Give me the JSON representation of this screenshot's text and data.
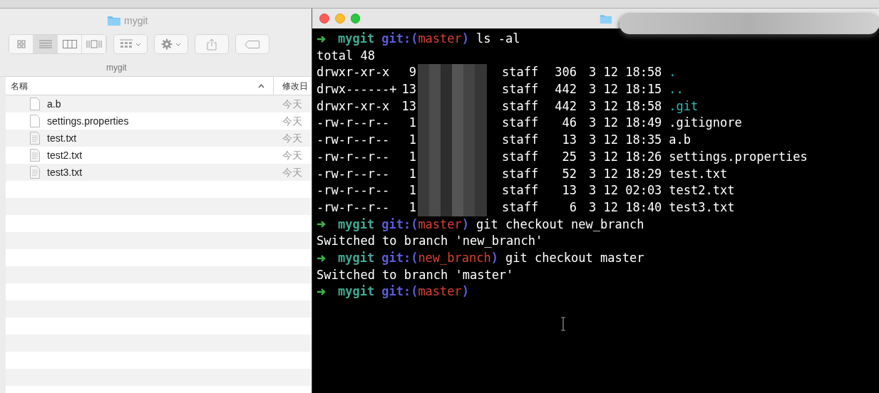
{
  "finder": {
    "title": "mygit",
    "path": "mygit",
    "view_modes": [
      {
        "kind": "icons",
        "selected": false
      },
      {
        "kind": "list",
        "selected": true
      },
      {
        "kind": "columns",
        "selected": false
      },
      {
        "kind": "cover",
        "selected": false
      }
    ],
    "columns": [
      {
        "label": "名稱",
        "sorted": true
      },
      {
        "label": "修改日",
        "sorted": false
      }
    ],
    "files": [
      {
        "name": "a.b",
        "modified": "今天",
        "kind": "blank"
      },
      {
        "name": "settings.properties",
        "modified": "今天",
        "kind": "blank"
      },
      {
        "name": "test.txt",
        "modified": "今天",
        "kind": "text"
      },
      {
        "name": "test2.txt",
        "modified": "今天",
        "kind": "text"
      },
      {
        "name": "test3.txt",
        "modified": "今天",
        "kind": "text"
      }
    ]
  },
  "terminal": {
    "lines": [
      {
        "kind": "prompt",
        "dir": "mygit",
        "vcs_open": "git:(",
        "branch": "master",
        "vcs_close": ")",
        "command": "ls -al"
      },
      {
        "kind": "output",
        "text": "total 48"
      },
      {
        "kind": "listing",
        "perms": "drwxr-xr-x",
        "links": "9",
        "group": "staff",
        "size": "306",
        "date": "3 12 18:58",
        "name": ".",
        "is_dir": true
      },
      {
        "kind": "listing",
        "perms": "drwx------+",
        "links": "13",
        "group": "staff",
        "size": "442",
        "date": "3 12 18:15",
        "name": "..",
        "is_dir": true
      },
      {
        "kind": "listing",
        "perms": "drwxr-xr-x",
        "links": "13",
        "group": "staff",
        "size": "442",
        "date": "3 12 18:58",
        "name": ".git",
        "is_dir": true
      },
      {
        "kind": "listing",
        "perms": "-rw-r--r--",
        "links": "1",
        "group": "staff",
        "size": "46",
        "date": "3 12 18:49",
        "name": ".gitignore",
        "is_dir": false
      },
      {
        "kind": "listing",
        "perms": "-rw-r--r--",
        "links": "1",
        "group": "staff",
        "size": "13",
        "date": "3 12 18:35",
        "name": "a.b",
        "is_dir": false
      },
      {
        "kind": "listing",
        "perms": "-rw-r--r--",
        "links": "1",
        "group": "staff",
        "size": "25",
        "date": "3 12 18:26",
        "name": "settings.properties",
        "is_dir": false
      },
      {
        "kind": "listing",
        "perms": "-rw-r--r--",
        "links": "1",
        "group": "staff",
        "size": "52",
        "date": "3 12 18:29",
        "name": "test.txt",
        "is_dir": false
      },
      {
        "kind": "listing",
        "perms": "-rw-r--r--",
        "links": "1",
        "group": "staff",
        "size": "13",
        "date": "3 12 02:03",
        "name": "test2.txt",
        "is_dir": false
      },
      {
        "kind": "listing",
        "perms": "-rw-r--r--",
        "links": "1",
        "group": "staff",
        "size": "6",
        "date": "3 12 18:40",
        "name": "test3.txt",
        "is_dir": false
      },
      {
        "kind": "prompt",
        "dir": "mygit",
        "vcs_open": "git:(",
        "branch": "master",
        "vcs_close": ")",
        "command": "git checkout new_branch"
      },
      {
        "kind": "output",
        "text": "Switched to branch 'new_branch'"
      },
      {
        "kind": "prompt",
        "dir": "mygit",
        "vcs_open": "git:(",
        "branch": "new_branch",
        "vcs_close": ")",
        "command": "git checkout master"
      },
      {
        "kind": "output",
        "text": "Switched to branch 'master'"
      },
      {
        "kind": "prompt",
        "dir": "mygit",
        "vcs_open": "git:(",
        "branch": "master",
        "vcs_close": ")"
      }
    ]
  }
}
